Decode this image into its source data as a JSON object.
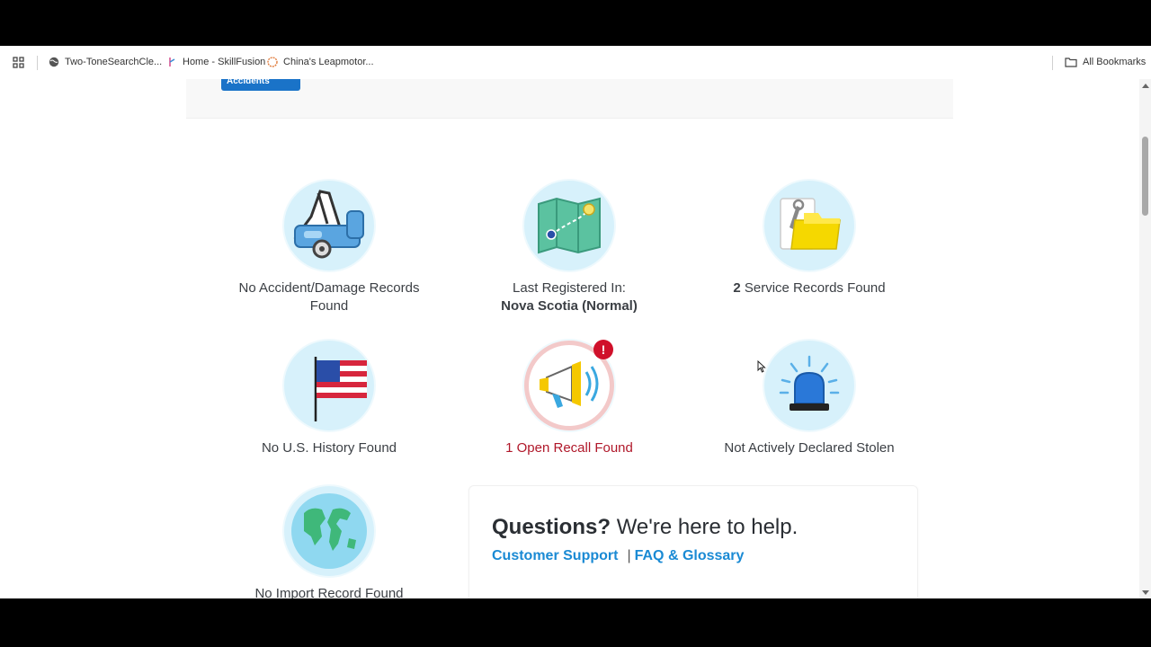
{
  "bookmarks": {
    "items": [
      {
        "label": "Two-ToneSearchCle...",
        "icon": "globe-icon"
      },
      {
        "label": "Home - SkillFusion",
        "icon": "skillfusion-icon"
      },
      {
        "label": "China's Leapmotor...",
        "icon": "leapmotor-icon"
      }
    ],
    "all_label": "All Bookmarks"
  },
  "accidents_button": {
    "label": "Accidents",
    "tm": "™"
  },
  "records": [
    {
      "icon": "tow-truck-icon",
      "line1": "No Accident/Damage Records",
      "line2": "Found"
    },
    {
      "icon": "map-icon",
      "line1": "Last Registered In:",
      "line2": "Nova Scotia (Normal)"
    },
    {
      "icon": "service-folder-icon",
      "count": "2",
      "text": "Service Records Found"
    },
    {
      "icon": "us-flag-icon",
      "line1": "No U.S. History Found"
    },
    {
      "icon": "megaphone-icon",
      "line1": "1 Open Recall Found",
      "alert": "!"
    },
    {
      "icon": "siren-icon",
      "line1": "Not Actively Declared Stolen"
    },
    {
      "icon": "globe-icon",
      "line1": "No Import Record Found"
    }
  ],
  "help": {
    "title_bold": "Questions?",
    "title_rest": "We're here to help.",
    "customer_support": "Customer Support",
    "pipe": "|",
    "faq": "FAQ & Glossary"
  },
  "colors": {
    "accent": "#1a73c8",
    "link": "#1a8ad4",
    "recall_red": "#b0182a",
    "icon_bg": "#d7f1fb"
  }
}
